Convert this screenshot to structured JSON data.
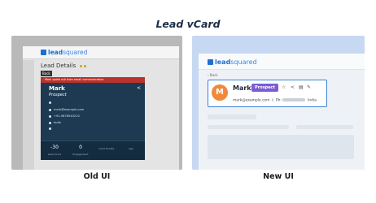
{
  "title": "Lead vCard",
  "old_ui": {
    "caption": "Old UI",
    "logo": {
      "part1": "lead",
      "part2": "squared"
    },
    "heading": "Lead Details",
    "back_label": "Back",
    "alert": "Mark opted out from email communication",
    "lead_name": "Mark",
    "lead_status": "Prospect",
    "email": "mark@example.com",
    "phone": "+91-9876543210",
    "location": "India",
    "stats": [
      {
        "value": "-30",
        "label": "Lead Score"
      },
      {
        "value": "0",
        "label": "Engagement"
      },
      {
        "value": "",
        "label": "Lead Quality"
      },
      {
        "value": "",
        "label": "Age"
      }
    ]
  },
  "new_ui": {
    "caption": "New UI",
    "logo": {
      "part1": "lead",
      "part2": "squared"
    },
    "back_label": "Back",
    "avatar_initial": "M",
    "lead_name": "Mark",
    "badge": "Prospect",
    "badge_color": "#7b5cd6",
    "highlight_color": "#3b82d6",
    "actions": [
      "star-icon",
      "share-icon",
      "notes-icon",
      "edit-icon"
    ],
    "email": "mark@example.com",
    "phone_prefix": "Ph:",
    "location": "India"
  }
}
